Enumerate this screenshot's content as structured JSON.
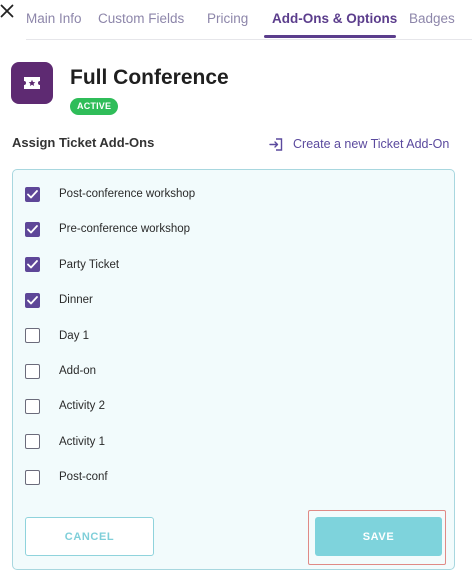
{
  "header": {
    "close_icon": "close-icon"
  },
  "tabs": [
    {
      "label": "Main Info",
      "active": false
    },
    {
      "label": "Custom Fields",
      "active": false
    },
    {
      "label": "Pricing",
      "active": false
    },
    {
      "label": "Add-Ons & Options",
      "active": true
    },
    {
      "label": "Badges",
      "active": false
    }
  ],
  "ticket": {
    "icon": "ticket-icon",
    "title": "Full Conference",
    "status": "ACTIVE"
  },
  "addons_section": {
    "title": "Assign Ticket Add-Ons",
    "create_link": "Create a new Ticket Add-On",
    "create_icon": "sign-in-icon"
  },
  "addons": [
    {
      "label": "Post-conference workshop",
      "checked": true
    },
    {
      "label": "Pre-conference workshop",
      "checked": true
    },
    {
      "label": "Party Ticket",
      "checked": true
    },
    {
      "label": "Dinner",
      "checked": true
    },
    {
      "label": "Day 1",
      "checked": false
    },
    {
      "label": "Add-on",
      "checked": false
    },
    {
      "label": "Activity 2",
      "checked": false
    },
    {
      "label": "Activity 1",
      "checked": false
    },
    {
      "label": "Post-conf",
      "checked": false
    }
  ],
  "actions": {
    "cancel_label": "CANCEL",
    "save_label": "SAVE"
  },
  "colors": {
    "brand_purple": "#5e2a72",
    "tab_active": "#5b3d8c",
    "status_green": "#2fbd59",
    "panel_bg": "#f2fbfc",
    "accent_teal": "#7ed3dc"
  }
}
